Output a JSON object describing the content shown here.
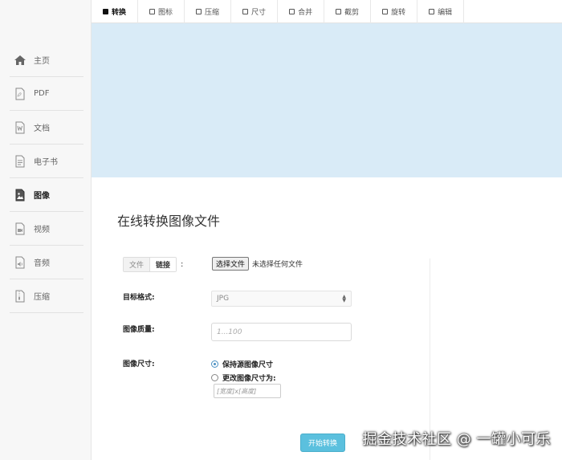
{
  "sidebar": {
    "items": [
      {
        "label": "主页",
        "icon": "home-icon",
        "active": false
      },
      {
        "label": "PDF",
        "icon": "pdf-file-icon",
        "active": false
      },
      {
        "label": "文档",
        "icon": "word-document-icon",
        "active": false
      },
      {
        "label": "电子书",
        "icon": "ebook-icon",
        "active": false
      },
      {
        "label": "图像",
        "icon": "image-icon",
        "active": true
      },
      {
        "label": "视频",
        "icon": "video-file-icon",
        "active": false
      },
      {
        "label": "音频",
        "icon": "audio-file-icon",
        "active": false
      },
      {
        "label": "压缩",
        "icon": "archive-file-icon",
        "active": false
      }
    ]
  },
  "tabs": [
    {
      "label": "转换",
      "active": true
    },
    {
      "label": "图标",
      "active": false
    },
    {
      "label": "压缩",
      "active": false
    },
    {
      "label": "尺寸",
      "active": false
    },
    {
      "label": "合并",
      "active": false
    },
    {
      "label": "截剪",
      "active": false
    },
    {
      "label": "旋转",
      "active": false
    },
    {
      "label": "编辑",
      "active": false
    }
  ],
  "main": {
    "title": "在线转换图像文件",
    "source_toggle": {
      "file_label": "文件",
      "link_label": "链接",
      "colon": ":"
    },
    "file_picker": {
      "button_label": "选择文件",
      "status": "未选择任何文件"
    },
    "target_format": {
      "label": "目标格式:",
      "value": "JPG"
    },
    "quality": {
      "label": "图像质量:",
      "placeholder": "1...100"
    },
    "size": {
      "label": "图像尺寸:",
      "keep_label": "保持源图像尺寸",
      "change_label": "更改图像尺寸为:",
      "placeholder": "[宽度]x[高度]"
    },
    "start_button": "开始转换"
  },
  "watermark": "掘金技术社区 @ 一罐小可乐",
  "colors": {
    "banner": "#d9ebf7",
    "accent": "#5bc0de",
    "sidebar_bg": "#f7f7f7"
  }
}
